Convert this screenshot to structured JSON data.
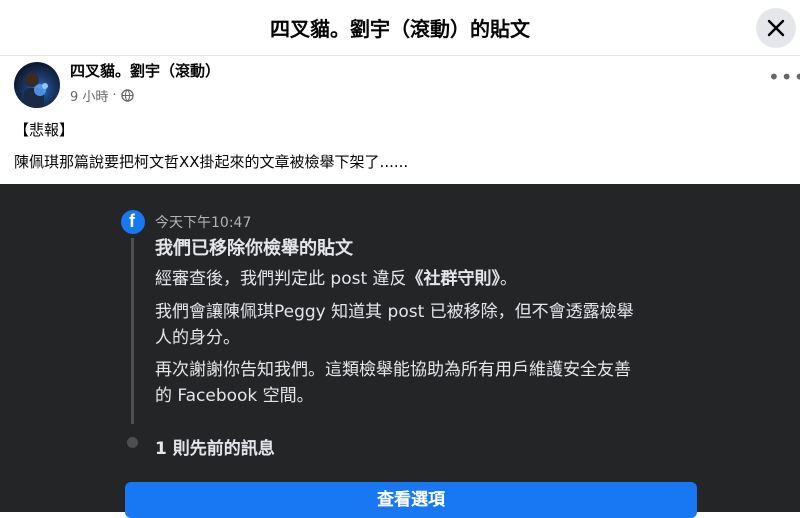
{
  "header": {
    "title": "四叉貓。劉宇（滾動）的貼文"
  },
  "post": {
    "author": "四叉貓。劉宇（滾動）",
    "time": "9 小時",
    "separator": "·",
    "privacy_icon": "globe-icon",
    "more_icon": "more-horizontal-icon",
    "lines": [
      "【悲報】",
      "陳佩琪那篇說要把柯文哲XX掛起來的文章被檢舉下架了......"
    ]
  },
  "notice": {
    "logo_letter": "f",
    "time": "今天下午10:47",
    "title": "我們已移除你檢舉的貼文",
    "p1_prefix": "經審查後，我們判定此 post 違反",
    "p1_bold": "《社群守則》",
    "p1_suffix": "。",
    "p2_line1": "我們會讓陳佩琪Peggy 知道其 post 已被移除，但不會透露檢舉",
    "p2_line2": "人的身分。",
    "p3_line1": "再次謝謝你告知我們。這類檢舉能協助為所有用戶維護安全友善",
    "p3_line2": "的 Facebook 空間。",
    "previous": "1 則先前的訊息",
    "button": "查看選項"
  },
  "colors": {
    "accent": "#1877f2",
    "dark_bg": "#242526",
    "dark_text": "#e4e6eb",
    "muted": "#65676b"
  }
}
